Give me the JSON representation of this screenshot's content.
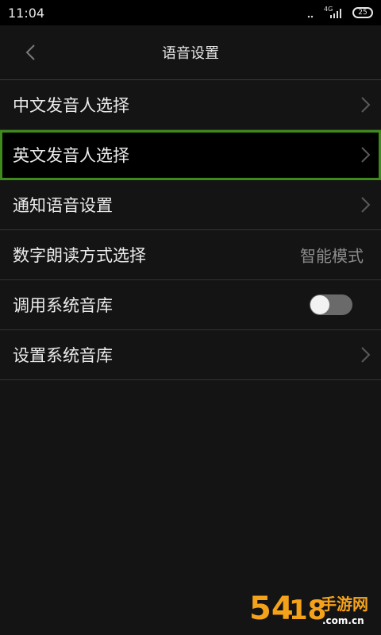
{
  "status_bar": {
    "time": "11:04",
    "network": "4G",
    "battery": "25"
  },
  "header": {
    "title": "语音设置",
    "back_icon": "chevron-left-icon"
  },
  "settings": {
    "items": [
      {
        "label": "中文发音人选择",
        "type": "link"
      },
      {
        "label": "英文发音人选择",
        "type": "link",
        "selected": true
      },
      {
        "label": "通知语音设置",
        "type": "link"
      },
      {
        "label": "数字朗读方式选择",
        "type": "value",
        "value": "智能模式"
      },
      {
        "label": "调用系统音库",
        "type": "toggle",
        "on": false
      },
      {
        "label": "设置系统音库",
        "type": "link"
      }
    ]
  },
  "watermark": {
    "text": "54188手游网 .com.cn"
  },
  "colors": {
    "background": "#141414",
    "selected_border": "#3f8a1c",
    "watermark_orange": "#f5a21b"
  }
}
